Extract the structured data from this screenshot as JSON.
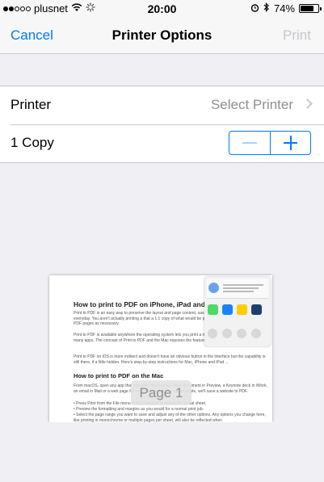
{
  "status_bar": {
    "carrier": "plusnet",
    "signal_filled": 2,
    "signal_total": 5,
    "wifi_icon": "wifi-icon",
    "activity_icon": "spinner-icon",
    "time": "20:00",
    "alarm_icon": "alarm-icon",
    "bluetooth_icon": "bluetooth-icon",
    "battery_percent": "74%",
    "battery_level": 0.74
  },
  "nav": {
    "cancel_label": "Cancel",
    "title": "Printer Options",
    "print_label": "Print"
  },
  "options": {
    "printer_label": "Printer",
    "printer_value": "Select Printer",
    "copies_label": "1 Copy",
    "stepper_minus": "minus-icon",
    "stepper_plus": "plus-icon"
  },
  "preview": {
    "page_label": "Page 1",
    "title": "How to print to PDF on iPhone, iPad and M",
    "para1": "Print to PDF is an easy way to preserve the layout and page content, save documents and websites you use everyday. You aren't actually printing a that a 1:1 copy of what would be printed as ink is instead saved as a PDF pages as necessary.",
    "para2": "Print to PDF is available anywhere the operating system lets you print a means it is widely available across many apps. The concept of Print to PDF and the Mac exposes the feature relatively prominently.",
    "para3": "Print to PDF on iOS is more indirect and doesn't have an obvious button in the interface but the capability is still there, if a little hidden. Here's step-by-step instructions for Mac, iPhone and iPad ...",
    "heading2": "How to print to PDF on the Mac",
    "para4": "From macOS, open any app that can print, such as an Office document in Preview, a Keynote deck in iWork, an email in Mail or a web page for better examples. For our example, we'll save a website to PDF.",
    "bullets": [
      "• Press Print from the File menu in the menubar to reveal the modal sheet.",
      "• Preview the formatting and margins as you would for a normal print job.",
      "• Select the page range you want to save and adjust any of the other options. Any options you change here, like printing in monochrome or multiple pages per sheet, will also be reflected when"
    ]
  }
}
